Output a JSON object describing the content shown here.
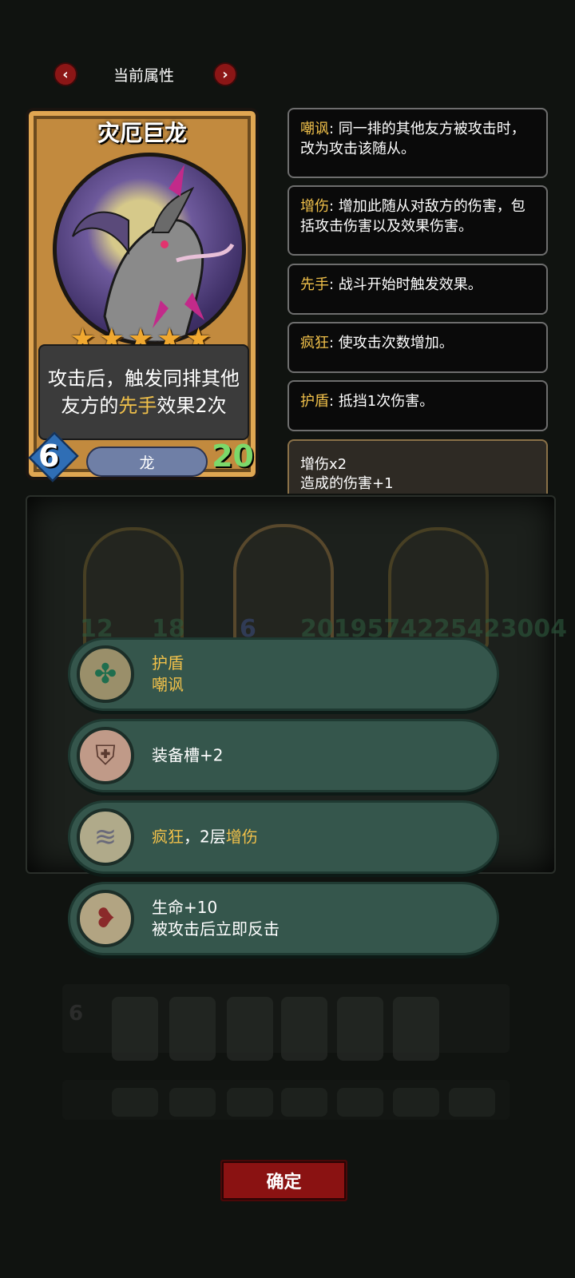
{
  "header": {
    "title": "当前属性",
    "prev": "‹",
    "next": "›"
  },
  "card": {
    "name": "灾厄巨龙",
    "stars": "★★★★★",
    "desc_before": "攻击后，触发同排其他友方的",
    "desc_keyword": "先手",
    "desc_after": "效果2次",
    "attack": "6",
    "health": "20",
    "race": "龙"
  },
  "keywords": [
    {
      "name": "嘲讽",
      "text": ": 同一排的其他友方被攻击时，改为攻击该随从。"
    },
    {
      "name": "增伤",
      "text": ": 增加此随从对敌方的伤害，包括攻击伤害以及效果伤害。"
    },
    {
      "name": "先手",
      "text": ": 战斗开始时触发效果。"
    },
    {
      "name": "疯狂",
      "text": ": 使攻击次数增加。"
    },
    {
      "name": "护盾",
      "text": ": 抵挡1次伤害。"
    }
  ],
  "buff": {
    "line1": "增伤x2",
    "line2": "造成的伤害+1"
  },
  "background": {
    "nums_left": [
      "12",
      "18"
    ],
    "nums_mid": "6",
    "nums_right": "2019574225423004",
    "mini_num": "6"
  },
  "options": [
    {
      "icon": "shield-creature-icon",
      "glyph": "✤",
      "line1_y": "护盾",
      "line2_y": "嘲讽",
      "line2_w": ""
    },
    {
      "icon": "armor-icon",
      "glyph": "⛨",
      "line1_w": "装备槽+2"
    },
    {
      "icon": "claw-icon",
      "glyph": "≋",
      "line1_y": "疯狂",
      "line1_w": "，2层",
      "line1_y2": "增伤"
    },
    {
      "icon": "heart-claw-icon",
      "glyph": "❥",
      "line1_w": "生命+10",
      "line2_w": "被攻击后立即反击"
    }
  ],
  "confirm": "确定",
  "colors": {
    "accent": "#f0c04a",
    "pill": "#35564c",
    "button": "#8a1212",
    "health": "#7cd86a"
  }
}
